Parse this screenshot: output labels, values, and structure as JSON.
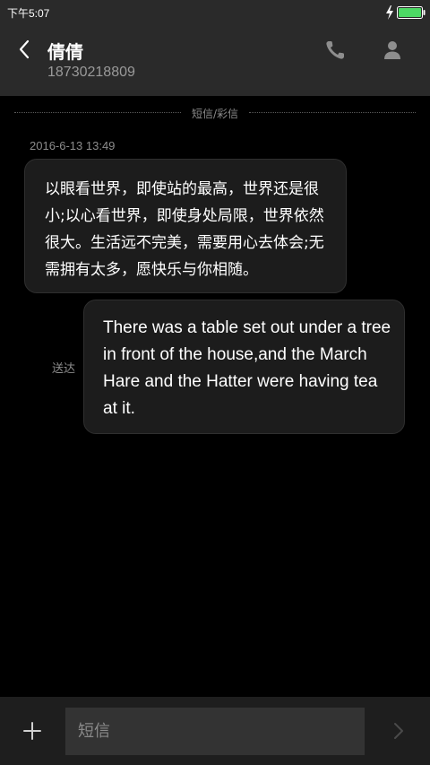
{
  "status_bar": {
    "time": "下午5:07",
    "battery_icon": "battery-full-icon",
    "charging_icon": "bolt-icon",
    "battery_color": "#4cd964"
  },
  "header": {
    "back_icon": "chevron-left-icon",
    "contact_name": "倩倩",
    "contact_number": "18730218809",
    "call_icon": "phone-icon",
    "contact_icon": "person-icon"
  },
  "thread": {
    "type_label": "短信/彩信",
    "timestamp": "2016-6-13 13:49",
    "messages": [
      {
        "direction": "incoming",
        "text": "以眼看世界，即使站的最高，世界还是很小;以心看世界，即使身处局限，世界依然很大。生活远不完美，需要用心去体会;无需拥有太多，愿快乐与你相随。"
      },
      {
        "direction": "outgoing",
        "status": "送达",
        "text": "There was a table set out under a tree in front of the house,and the March Hare and the Hatter were having tea at it."
      }
    ]
  },
  "composer": {
    "add_icon": "plus-icon",
    "placeholder": "短信",
    "value": "",
    "send_icon": "chevron-right-icon"
  },
  "colors": {
    "background": "#000000",
    "bar": "#2a2a2a",
    "bubble": "#1c1c1c",
    "secondary_text": "#8c8c8c"
  }
}
